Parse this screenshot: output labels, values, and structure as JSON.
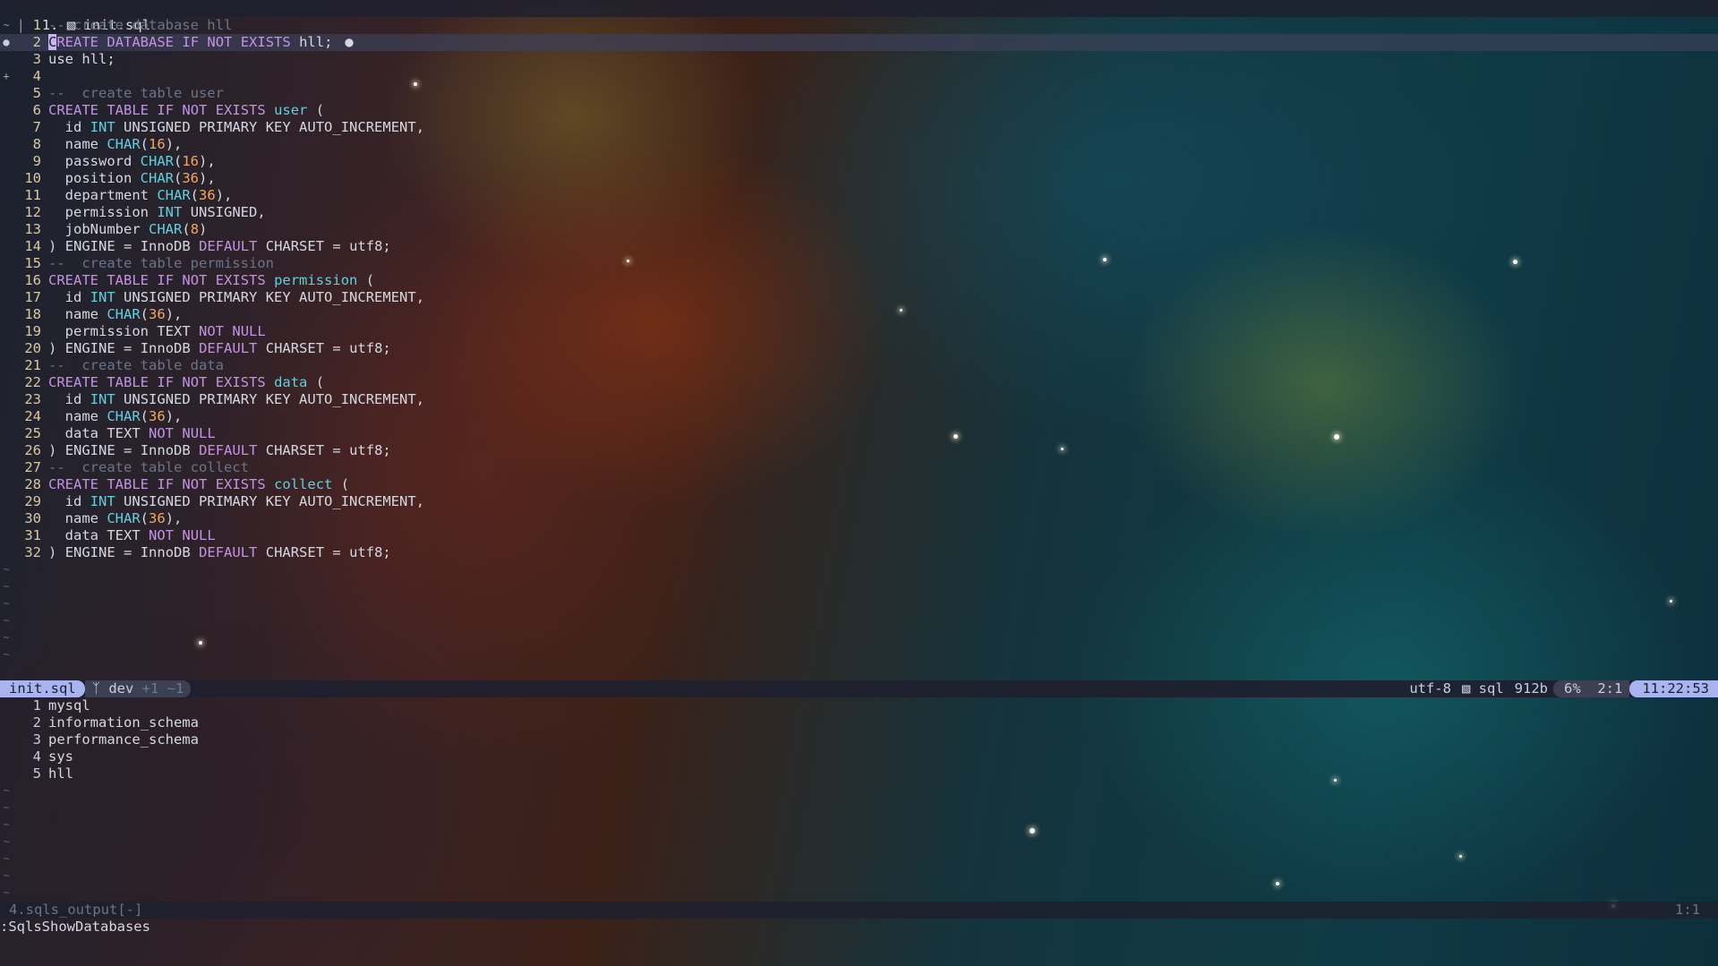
{
  "tabline": {
    "tab_number": "1.",
    "file_icon": "database-icon",
    "filename": "init.sql"
  },
  "editor": {
    "current_line": 2,
    "lines": [
      {
        "n": "1",
        "sign": "~",
        "text": "-- create database hll"
      },
      {
        "n": "2",
        "sign": "bulb",
        "text": "CREATE DATABASE IF NOT EXISTS hll;"
      },
      {
        "n": "3",
        "sign": "",
        "text": "use hll;"
      },
      {
        "n": "4",
        "sign": "+",
        "text": ""
      },
      {
        "n": "5",
        "sign": "",
        "text": "--  create table user"
      },
      {
        "n": "6",
        "sign": "",
        "text": "CREATE TABLE IF NOT EXISTS user ("
      },
      {
        "n": "7",
        "sign": "",
        "text": "  id INT UNSIGNED PRIMARY KEY AUTO_INCREMENT,"
      },
      {
        "n": "8",
        "sign": "",
        "text": "  name CHAR(16),"
      },
      {
        "n": "9",
        "sign": "",
        "text": "  password CHAR(16),"
      },
      {
        "n": "10",
        "sign": "",
        "text": "  position CHAR(36),"
      },
      {
        "n": "11",
        "sign": "",
        "text": "  department CHAR(36),"
      },
      {
        "n": "12",
        "sign": "",
        "text": "  permission INT UNSIGNED,"
      },
      {
        "n": "13",
        "sign": "",
        "text": "  jobNumber CHAR(8)"
      },
      {
        "n": "14",
        "sign": "",
        "text": ") ENGINE = InnoDB DEFAULT CHARSET = utf8;"
      },
      {
        "n": "15",
        "sign": "",
        "text": "--  create table permission"
      },
      {
        "n": "16",
        "sign": "",
        "text": "CREATE TABLE IF NOT EXISTS permission ("
      },
      {
        "n": "17",
        "sign": "",
        "text": "  id INT UNSIGNED PRIMARY KEY AUTO_INCREMENT,"
      },
      {
        "n": "18",
        "sign": "",
        "text": "  name CHAR(36),"
      },
      {
        "n": "19",
        "sign": "",
        "text": "  permission TEXT NOT NULL"
      },
      {
        "n": "20",
        "sign": "",
        "text": ") ENGINE = InnoDB DEFAULT CHARSET = utf8;"
      },
      {
        "n": "21",
        "sign": "",
        "text": "--  create table data"
      },
      {
        "n": "22",
        "sign": "",
        "text": "CREATE TABLE IF NOT EXISTS data ("
      },
      {
        "n": "23",
        "sign": "",
        "text": "  id INT UNSIGNED PRIMARY KEY AUTO_INCREMENT,"
      },
      {
        "n": "24",
        "sign": "",
        "text": "  name CHAR(36),"
      },
      {
        "n": "25",
        "sign": "",
        "text": "  data TEXT NOT NULL"
      },
      {
        "n": "26",
        "sign": "",
        "text": ") ENGINE = InnoDB DEFAULT CHARSET = utf8;"
      },
      {
        "n": "27",
        "sign": "",
        "text": "--  create table collect"
      },
      {
        "n": "28",
        "sign": "",
        "text": "CREATE TABLE IF NOT EXISTS collect ("
      },
      {
        "n": "29",
        "sign": "",
        "text": "  id INT UNSIGNED PRIMARY KEY AUTO_INCREMENT,"
      },
      {
        "n": "30",
        "sign": "",
        "text": "  name CHAR(36),"
      },
      {
        "n": "31",
        "sign": "",
        "text": "  data TEXT NOT NULL"
      },
      {
        "n": "32",
        "sign": "",
        "text": ") ENGINE = InnoDB DEFAULT CHARSET = utf8;"
      }
    ],
    "empty_markers": 6
  },
  "statusline": {
    "filename": "init.sql",
    "branch_icon": "git-branch-icon",
    "branch": "dev",
    "diff": "+1 ~1",
    "encoding": "utf-8",
    "filetype_icon": "database-icon",
    "filetype": "sql",
    "filesize": "912b",
    "percent": "6%",
    "position": "2:1",
    "time": "11:22:53"
  },
  "output": {
    "rows": [
      {
        "n": "1",
        "text": "mysql"
      },
      {
        "n": "2",
        "text": "information_schema"
      },
      {
        "n": "3",
        "text": "performance_schema"
      },
      {
        "n": "4",
        "text": "sys"
      },
      {
        "n": "5",
        "text": "hll"
      }
    ],
    "empty_markers": 7
  },
  "bottom_status": {
    "buffer": "4.sqls_output[-]",
    "position": "1:1"
  },
  "command_line": ":SqlsShowDatabases"
}
